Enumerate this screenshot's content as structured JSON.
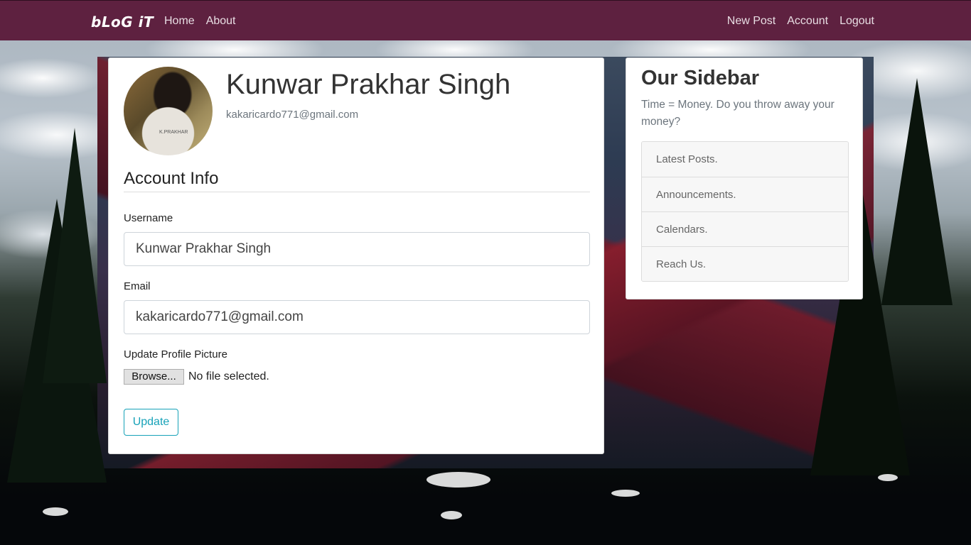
{
  "navbar": {
    "brand": "bLoG iT",
    "left_links": [
      "Home",
      "About"
    ],
    "right_links": [
      "New Post",
      "Account",
      "Logout"
    ],
    "background_color": "#5e2140"
  },
  "profile": {
    "name": "Kunwar Prakhar Singh",
    "email": "kakaricardo771@gmail.com",
    "avatar_text": "K.PRAKHAR"
  },
  "account_form": {
    "section_title": "Account Info",
    "username_label": "Username",
    "username_value": "Kunwar Prakhar Singh",
    "email_label": "Email",
    "email_value": "kakaricardo771@gmail.com",
    "picture_label": "Update Profile Picture",
    "browse_label": "Browse...",
    "file_status": "No file selected.",
    "update_label": "Update",
    "accent_color": "#17a2b8"
  },
  "sidebar": {
    "title": "Our Sidebar",
    "text": "Time = Money. Do you throw away your money?",
    "items": [
      "Latest Posts.",
      "Announcements.",
      "Calendars.",
      "Reach Us."
    ]
  }
}
